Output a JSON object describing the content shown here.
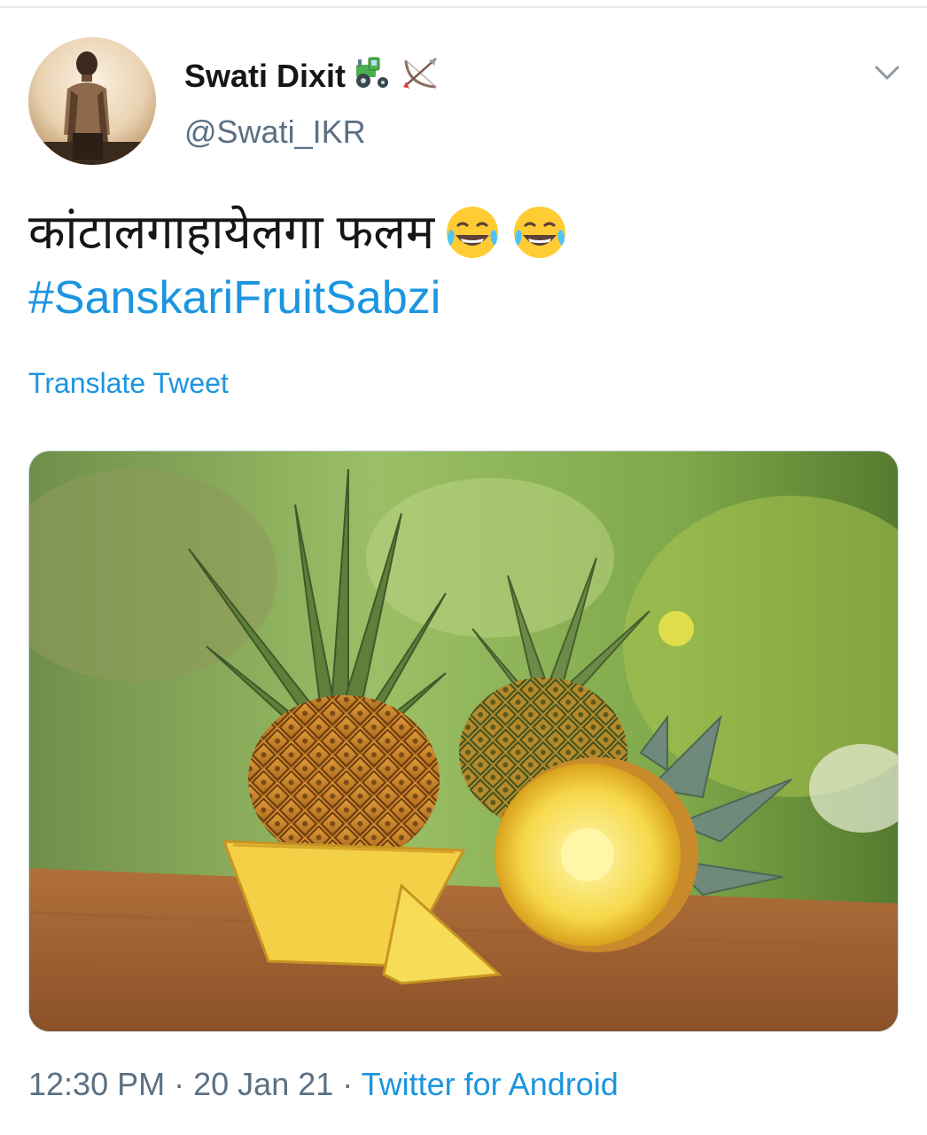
{
  "tweet": {
    "author": {
      "name": "Swati Dixit",
      "name_emojis": [
        "tractor-emoji",
        "bow-and-arrow-emoji"
      ],
      "handle": "@Swati_IKR",
      "avatar_icon": "profile-photo"
    },
    "text": "कांटालगाहायेलगा फलम",
    "text_emojis": [
      "face-with-tears-of-joy-emoji",
      "face-with-tears-of-joy-emoji"
    ],
    "hashtag": "#SanskariFruitSabzi",
    "translate_label": "Translate Tweet",
    "media_description_icon": "pineapple-photo",
    "time": "12:30 PM",
    "separator": "·",
    "date": "20 Jan 21",
    "source": "Twitter for Android"
  },
  "colors": {
    "link": "#1b95e0",
    "secondary_text": "#5b7083",
    "primary_text": "#14171a",
    "divider": "#e1e8ed"
  },
  "icons": {
    "menu": "chevron-down-icon"
  }
}
